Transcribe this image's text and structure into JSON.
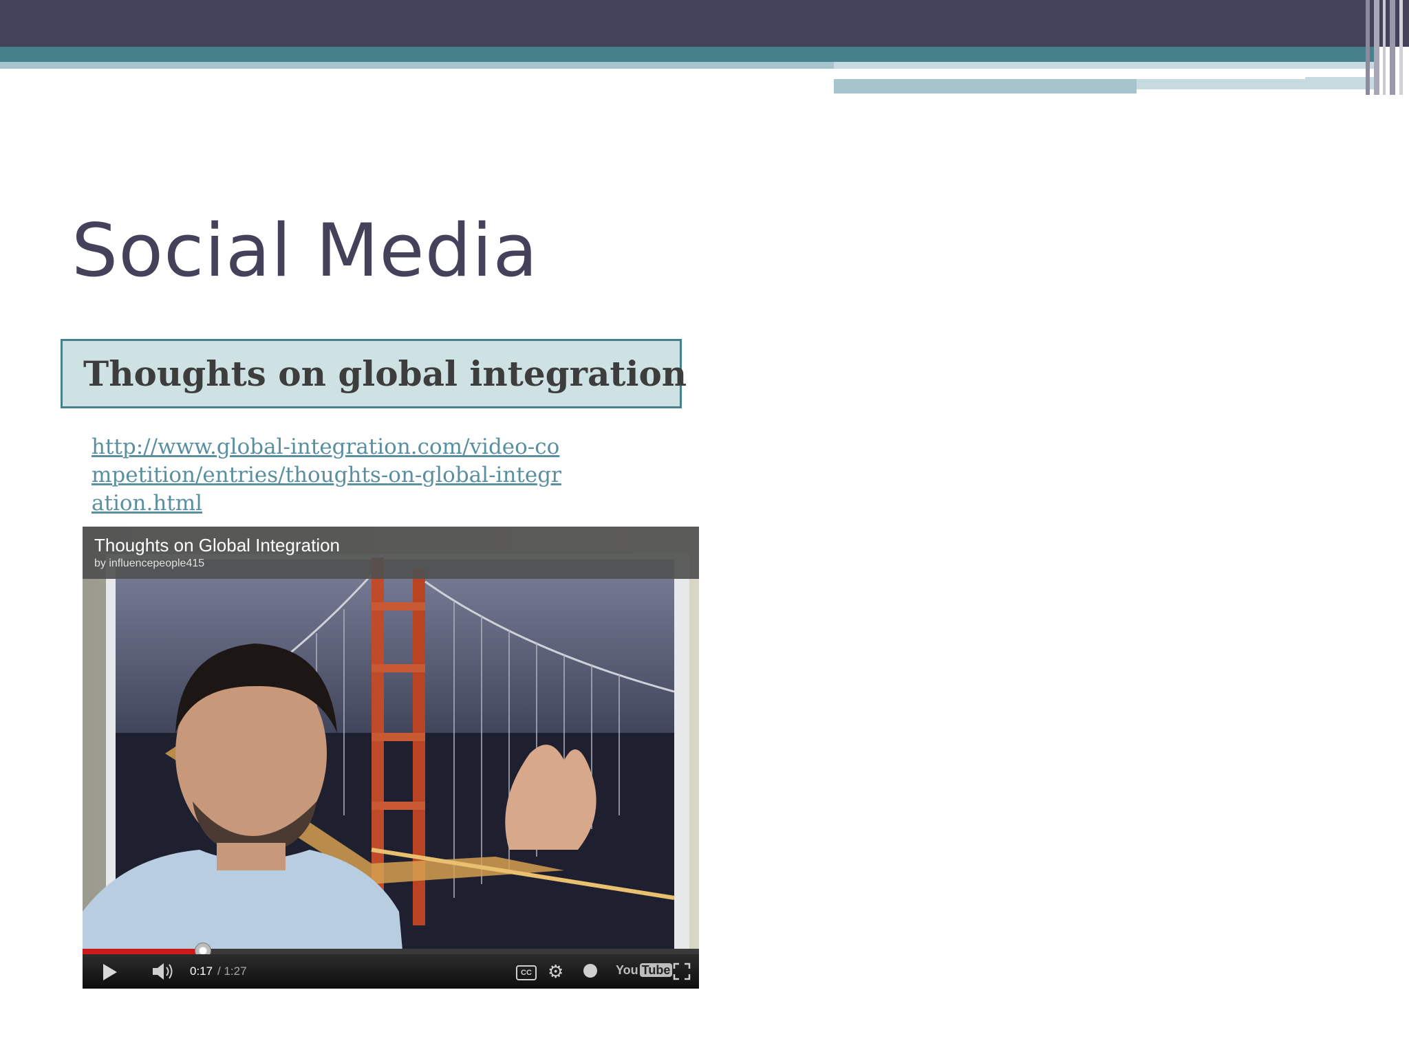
{
  "slide": {
    "title": "Social Media",
    "subtitle": "Thoughts on global integration",
    "link_text": "http://www.global-integration.com/video-competition/entries/thoughts-on-global-integration.html"
  },
  "video": {
    "title": "Thoughts on Global Integration",
    "author": "by influencepeople415",
    "time_current": "0:17",
    "time_total": " / 1:27",
    "progress_fraction": 0.195,
    "cc_label": "CC",
    "youtube_you": "You",
    "youtube_tube": "Tube"
  },
  "icons": {
    "play": "play-icon",
    "volume": "volume-icon",
    "cc": "closed-captions-icon",
    "settings": "gear-icon",
    "watch_later": "clock-icon",
    "fullscreen": "fullscreen-icon"
  },
  "colors": {
    "header_dark": "#43425a",
    "accent_teal": "#46808a",
    "subtitle_fill": "#cfe2e3",
    "link": "#5a8fa0",
    "progress": "#cc1b1b"
  }
}
